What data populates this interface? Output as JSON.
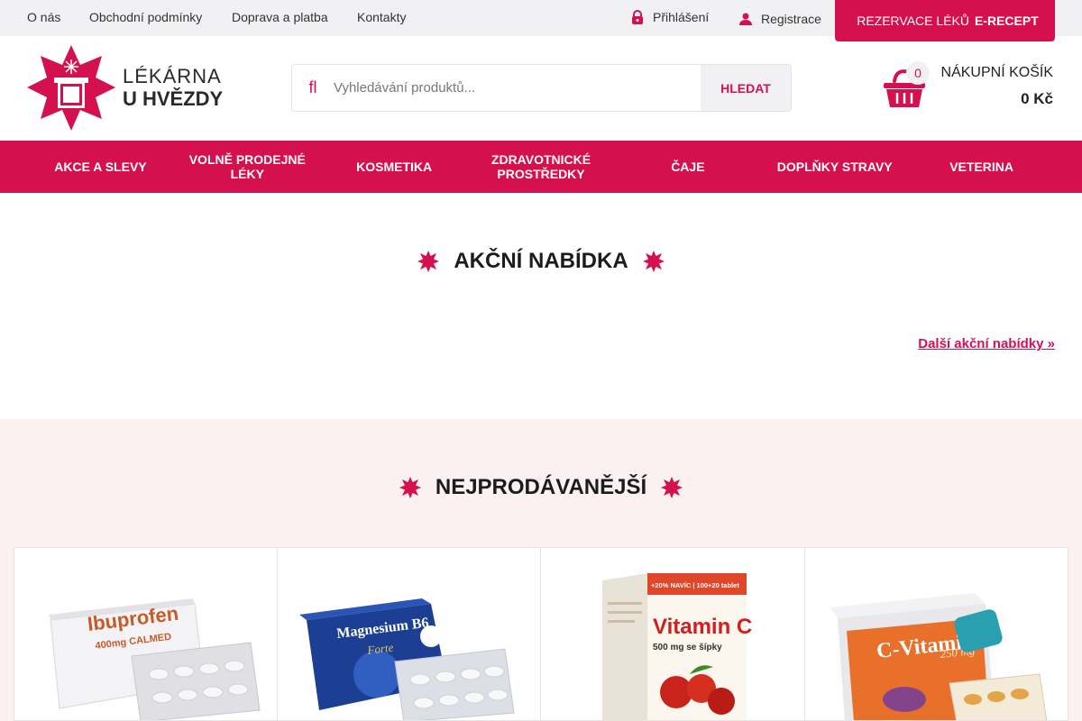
{
  "topbar": {
    "links": [
      "O nás",
      "Obchodní podmínky",
      "Doprava a platba",
      "Kontakty"
    ],
    "login": "Přihlášení",
    "register": "Registrace",
    "erecept_prefix": "REZERVACE LÉKŮ",
    "erecept_bold": "E-RECEPT"
  },
  "logo": {
    "line1": "LÉKÁRNA",
    "line2": "U HVĚZDY"
  },
  "search": {
    "placeholder": "Vyhledávání produktů...",
    "button": "HLEDAT",
    "icon": "fl"
  },
  "cart": {
    "count": "0",
    "title": "NÁKUPNÍ KOŠÍK",
    "price": "0 Kč"
  },
  "nav": [
    "AKCE A SLEVY",
    "VOLNĚ PRODEJNÉ LÉKY",
    "KOSMETIKA",
    "ZDRAVOTNICKÉ PROSTŘEDKY",
    "ČAJE",
    "DOPLŇKY STRAVY",
    "VETERINA"
  ],
  "sections": {
    "offers_title": "AKČNÍ NABÍDKA",
    "offers_more": "Další akční nabídky »",
    "bestsellers_title": "NEJPRODÁVANĚJŠÍ"
  },
  "products": [
    {
      "name": "Ibuprofen",
      "sub": "400mg CALMED",
      "icon": "ibuprofen-box"
    },
    {
      "name": "Magnesium B6",
      "sub": "Forte",
      "icon": "magnesium-box"
    },
    {
      "name": "Vitamin C",
      "sub": "500 mg se šípky",
      "top": "+20% NAVÍC | 100+20 tablet",
      "icon": "vitamin-c-box"
    },
    {
      "name": "C-Vitamin",
      "sub": "250 mg",
      "icon": "c-vitamin-box"
    }
  ],
  "colors": {
    "brand": "#d4104f",
    "topbar": "#f1f1f4",
    "band": "#fbf0f2"
  }
}
